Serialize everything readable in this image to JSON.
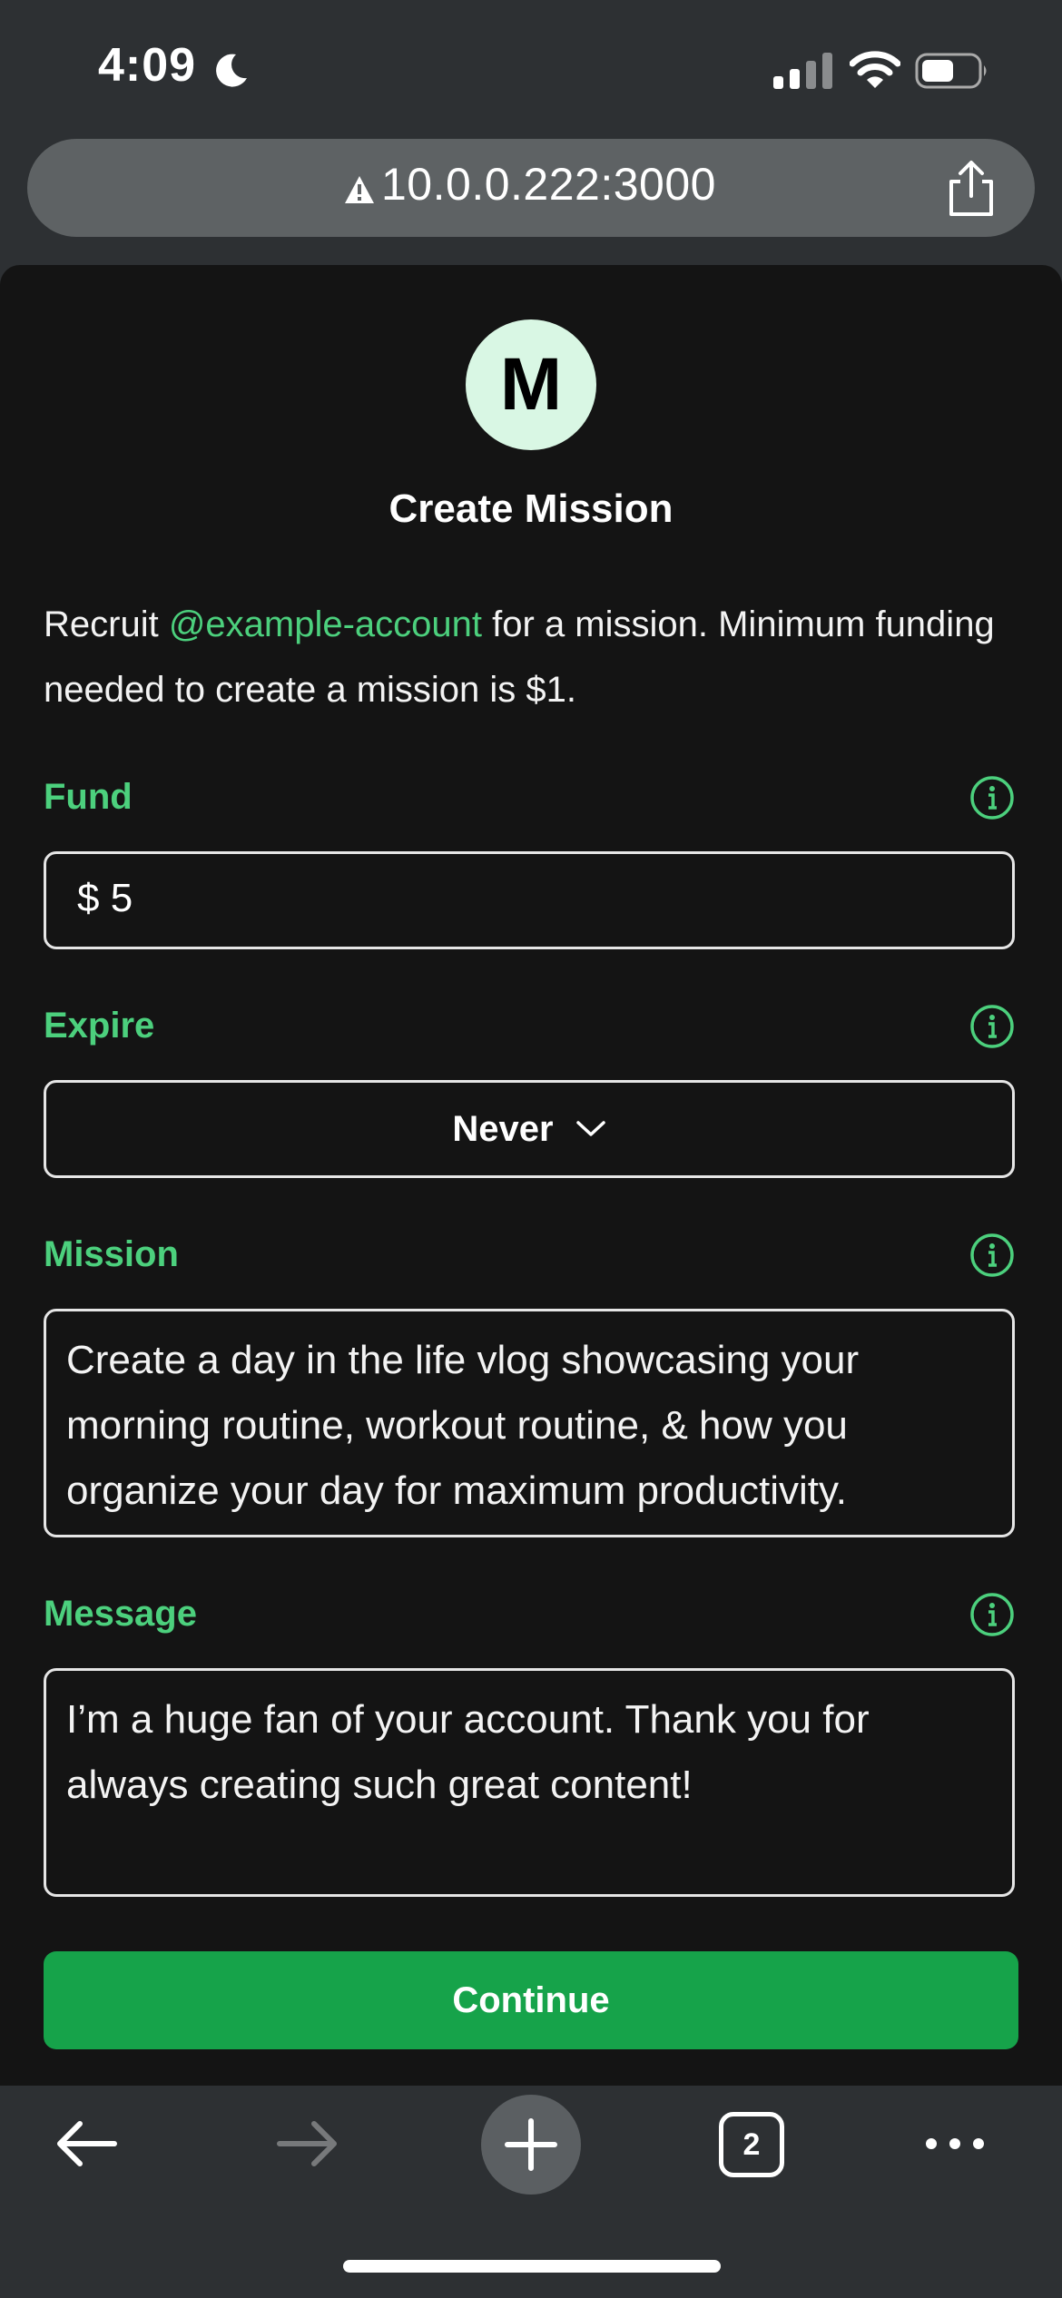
{
  "status_bar": {
    "time": "4:09"
  },
  "browser": {
    "url": "10.0.0.222:3000",
    "open_tabs": "2"
  },
  "page": {
    "avatar_letter": "M",
    "title": "Create Mission",
    "description_prefix": "Recruit ",
    "account": "@example-account",
    "description_suffix": " for a mission. Minimum funding needed to create a mission is $1.",
    "fund": {
      "label": "Fund",
      "value": "$ 5"
    },
    "expire": {
      "label": "Expire",
      "value": "Never"
    },
    "mission": {
      "label": "Mission",
      "value": "Create a day in the life vlog showcasing your morning routine, workout routine, & how you organize your day for maximum productivity."
    },
    "message": {
      "label": "Message",
      "value": "I’m a huge fan of your account. Thank you for always creating such great content!"
    },
    "continue_label": "Continue"
  },
  "colors": {
    "accent": "#4cd07d",
    "button": "#16a34a",
    "background": "#141414",
    "chrome": "#2d3033"
  }
}
